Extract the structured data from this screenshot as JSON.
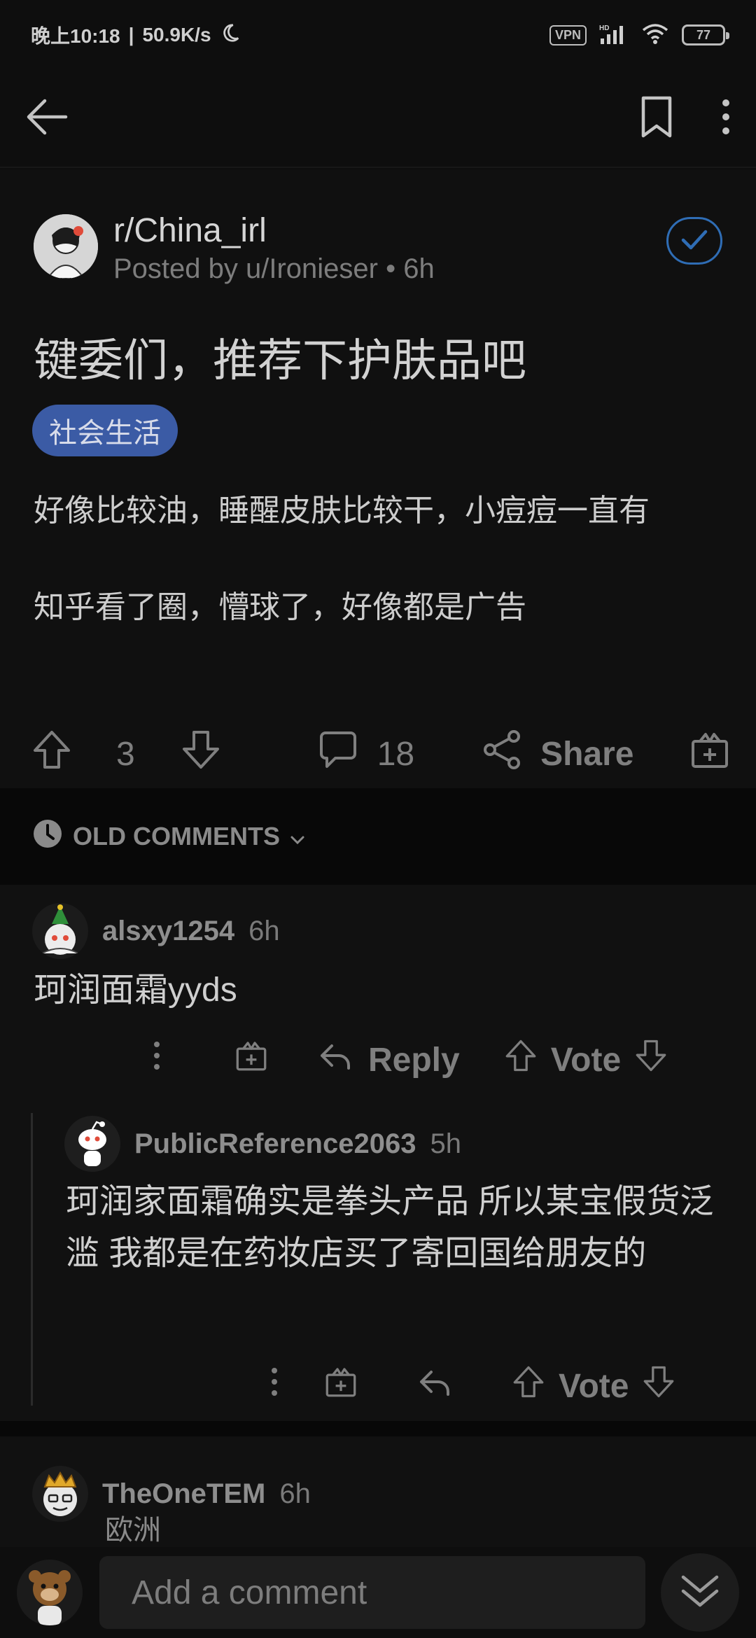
{
  "status_bar": {
    "time": "晚上10:18",
    "separator": "|",
    "speed": "50.9K/s",
    "vpn": "VPN",
    "battery": "77"
  },
  "app_bar": {
    "back_icon": "back-arrow-icon",
    "bookmark_icon": "bookmark-icon",
    "more_icon": "more-vertical-icon"
  },
  "post": {
    "subreddit": "r/China_irl",
    "posted_by": "Posted by u/Ironieser • 6h",
    "title": "键委们，推荐下护肤品吧",
    "flair": "社会生活",
    "body": [
      "好像比较油，睡醒皮肤比较干，小痘痘一直有",
      "知乎看了圈，懵球了，好像都是广告"
    ],
    "votes": "3",
    "comments": "18",
    "share_label": "Share",
    "accent": "#2f6db5",
    "flair_color": "#3b5ba5"
  },
  "sort": {
    "label": "OLD COMMENTS"
  },
  "comments": [
    {
      "user": "alsxy1254",
      "time": "6h",
      "body": "珂润面霜yyds",
      "reply_label": "Reply",
      "vote_label": "Vote"
    },
    {
      "user": "PublicReference2063",
      "time": "5h",
      "body": "珂润家面霜确实是拳头产品 所以某宝假货泛滥 我都是在药妆店买了寄回国给朋友的",
      "vote_label": "Vote"
    },
    {
      "user": "TheOneTEM",
      "time": "6h",
      "body": "欧洲"
    }
  ],
  "bottom_bar": {
    "placeholder": "Add a comment"
  }
}
